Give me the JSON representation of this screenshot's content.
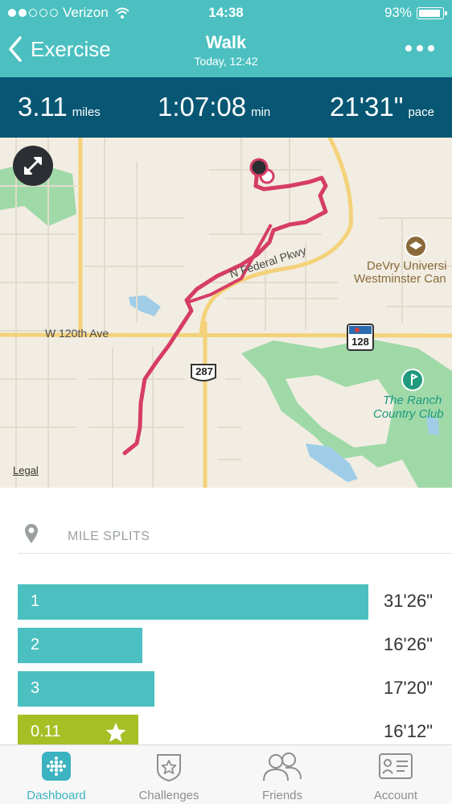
{
  "status_bar": {
    "carrier": "Verizon",
    "time": "14:38",
    "battery": "93%"
  },
  "nav": {
    "back_label": "Exercise",
    "title": "Walk",
    "subtitle": "Today, 12:42"
  },
  "stats": {
    "distance": {
      "value": "3.11",
      "unit": "miles"
    },
    "duration": {
      "value": "1:07:08",
      "unit": "min"
    },
    "pace": {
      "value": "21'31\"",
      "unit": "pace"
    }
  },
  "map": {
    "labels": {
      "road_federal": "N Federal Pkwy",
      "road_120th": "W 120th Ave",
      "shield_287": "287",
      "shield_128": "128",
      "university_line1": "DeVry Universi",
      "university_line2": "Westminster Can",
      "club_line1": "The Ranch",
      "club_line2": "Country Club"
    },
    "legal": "Legal",
    "colors": {
      "route": "#d63d66",
      "park": "#9fd9a8",
      "water": "#9fcde8",
      "road": "#f4d27a"
    }
  },
  "splits": {
    "title": "MILE SPLITS",
    "items": [
      {
        "label": "1",
        "time": "31'26\"",
        "fraction": 1.0,
        "partial": false
      },
      {
        "label": "2",
        "time": "16'26\"",
        "fraction": 0.355,
        "partial": false
      },
      {
        "label": "3",
        "time": "17'20\"",
        "fraction": 0.39,
        "partial": false
      },
      {
        "label": "0.11",
        "time": "16'12\"",
        "fraction": 0.345,
        "partial": true
      }
    ]
  },
  "tabs": [
    {
      "label": "Dashboard",
      "icon": "dashboard-icon",
      "active": true
    },
    {
      "label": "Challenges",
      "icon": "challenges-icon",
      "active": false
    },
    {
      "label": "Friends",
      "icon": "friends-icon",
      "active": false
    },
    {
      "label": "Account",
      "icon": "account-icon",
      "active": false
    }
  ],
  "colors": {
    "header": "#4cc0c0",
    "stats_bar": "#075774",
    "split_bar": "#4cc0c0",
    "partial_split_bar": "#a6bf25",
    "active_tab": "#3cb3c0"
  }
}
